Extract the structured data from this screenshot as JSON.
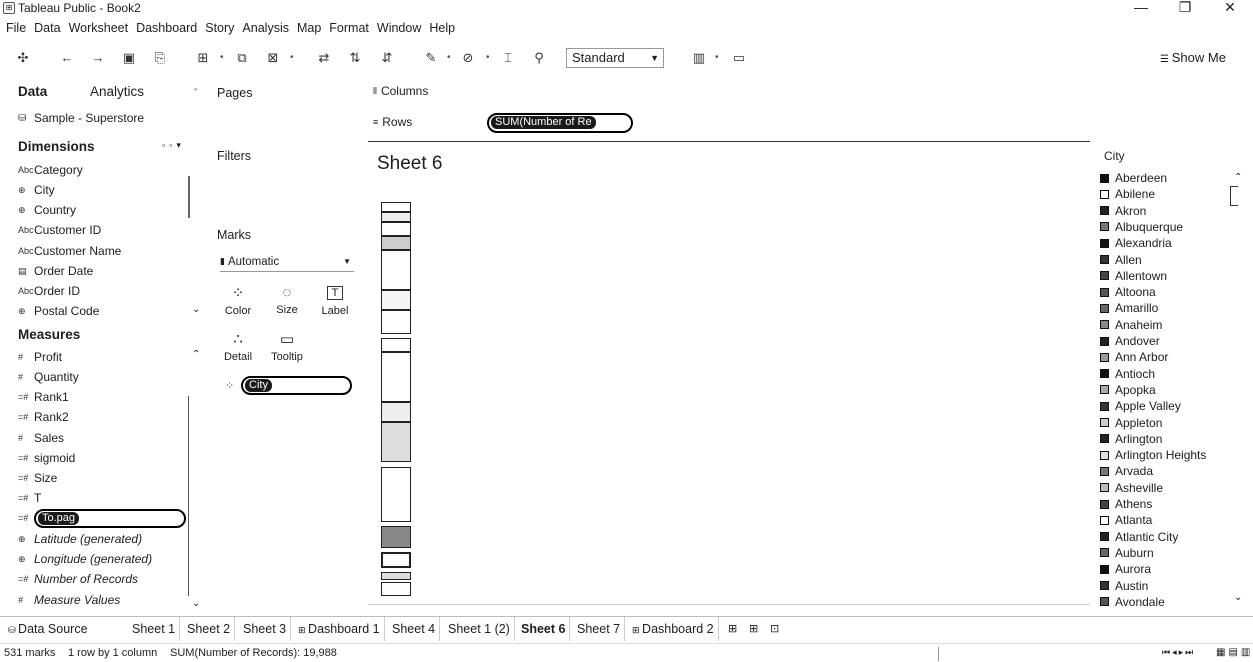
{
  "window": {
    "title": "Tableau Public - Book2",
    "minimize": "—",
    "maximize": "❐",
    "close": "✕"
  },
  "menu": [
    "File",
    "Data",
    "Worksheet",
    "Dashboard",
    "Story",
    "Analysis",
    "Map",
    "Format",
    "Window",
    "Help"
  ],
  "toolbar": {
    "fit_value": "Standard",
    "show_me": "Show Me"
  },
  "data_pane": {
    "tab_data": "Data",
    "tab_analytics": "Analytics",
    "datasource": "Sample - Superstore",
    "dimensions_header": "Dimensions",
    "dimensions": [
      {
        "icon": "Abc",
        "label": "Category"
      },
      {
        "icon": "⊕",
        "label": "City"
      },
      {
        "icon": "⊕",
        "label": "Country"
      },
      {
        "icon": "Abc",
        "label": "Customer ID"
      },
      {
        "icon": "Abc",
        "label": "Customer Name"
      },
      {
        "icon": "▤",
        "label": "Order Date"
      },
      {
        "icon": "Abc",
        "label": "Order ID"
      },
      {
        "icon": "⊕",
        "label": "Postal Code"
      }
    ],
    "measures_header": "Measures",
    "measures": [
      {
        "icon": "#",
        "label": "Profit",
        "italic": false
      },
      {
        "icon": "#",
        "label": "Quantity",
        "italic": false
      },
      {
        "icon": "=#",
        "label": "Rank1",
        "italic": false
      },
      {
        "icon": "=#",
        "label": "Rank2",
        "italic": false
      },
      {
        "icon": "#",
        "label": "Sales",
        "italic": false
      },
      {
        "icon": "=#",
        "label": "sigmoid",
        "italic": false
      },
      {
        "icon": "=#",
        "label": "Size",
        "italic": false
      },
      {
        "icon": "=#",
        "label": "T",
        "italic": false
      },
      {
        "icon": "=#",
        "label": "",
        "italic": false
      },
      {
        "icon": "⊕",
        "label": "Latitude (generated)",
        "italic": true
      },
      {
        "icon": "⊕",
        "label": "Longitude (generated)",
        "italic": true
      },
      {
        "icon": "=#",
        "label": "Number of Records",
        "italic": true
      },
      {
        "icon": "#",
        "label": "Measure Values",
        "italic": true
      }
    ],
    "measure_pill": "To.pag"
  },
  "cards": {
    "pages": "Pages",
    "filters": "Filters",
    "marks": "Marks",
    "mark_type": "Automatic",
    "buttons": [
      {
        "icon": "⁘",
        "label": "Color"
      },
      {
        "icon": "◌",
        "label": "Size"
      },
      {
        "icon": "T",
        "label": "Label"
      },
      {
        "icon": "∴",
        "label": "Detail"
      },
      {
        "icon": "▭",
        "label": "Tooltip"
      }
    ],
    "marks_pill": "City"
  },
  "shelves": {
    "columns": "Columns",
    "rows": "Rows",
    "rows_pill": "SUM(Number of Re"
  },
  "sheet_title": "Sheet 6",
  "legend": {
    "title": "City",
    "items": [
      "Aberdeen",
      "Abilene",
      "Akron",
      "Albuquerque",
      "Alexandria",
      "Allen",
      "Allentown",
      "Altoona",
      "Amarillo",
      "Anaheim",
      "Andover",
      "Ann Arbor",
      "Antioch",
      "Apopka",
      "Apple Valley",
      "Appleton",
      "Arlington",
      "Arlington Heights",
      "Arvada",
      "Asheville",
      "Athens",
      "Atlanta",
      "Atlantic City",
      "Auburn",
      "Aurora",
      "Austin",
      "Avondale"
    ],
    "swatches": [
      "#111111",
      "#ffffff",
      "#222222",
      "#777777",
      "#111111",
      "#333333",
      "#444444",
      "#555555",
      "#666666",
      "#888888",
      "#222222",
      "#999999",
      "#111111",
      "#aaaaaa",
      "#333333",
      "#cccccc",
      "#222222",
      "#dddddd",
      "#777777",
      "#bbbbbb",
      "#444444",
      "#ffffff",
      "#222222",
      "#666666",
      "#111111",
      "#333333",
      "#555555"
    ]
  },
  "tabs": {
    "data_source": "Data Source",
    "items": [
      "Sheet 1",
      "Sheet 2",
      "Sheet 3",
      "Dashboard 1",
      "Sheet 4",
      "Sheet 1 (2)",
      "Sheet 6",
      "Sheet 7",
      "Dashboard 2"
    ],
    "active": "Sheet 6"
  },
  "status": {
    "marks": "531 marks",
    "dims": "1 row by 1 column",
    "sum": "SUM(Number of Records): 19,988"
  }
}
